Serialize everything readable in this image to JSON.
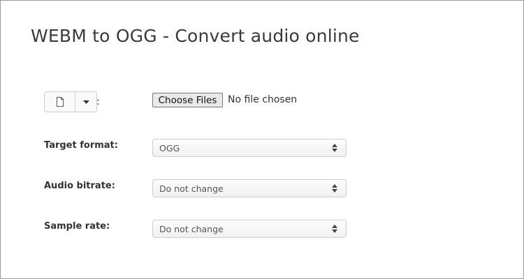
{
  "page": {
    "title": "WEBM to OGG - Convert audio online"
  },
  "source": {
    "icons": [
      "file-icon",
      "caret-down-icon"
    ],
    "separator": ":"
  },
  "file_input": {
    "button_label": "Choose Files",
    "status": "No file chosen"
  },
  "fields": [
    {
      "label": "Target format:",
      "value": "OGG"
    },
    {
      "label": "Audio bitrate:",
      "value": "Do not change"
    },
    {
      "label": "Sample rate:",
      "value": "Do not change"
    }
  ]
}
